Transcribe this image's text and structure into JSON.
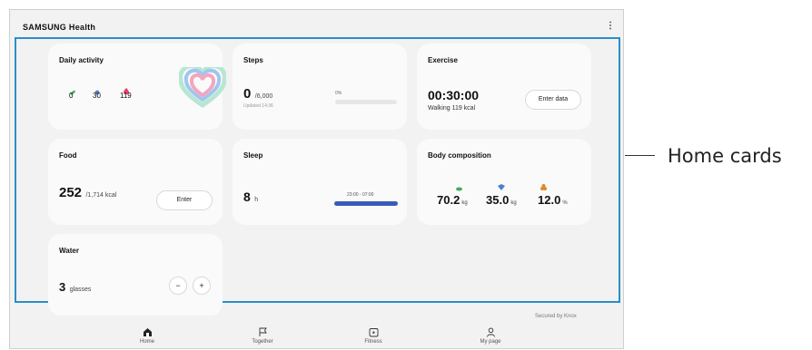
{
  "app": {
    "title": "SAMSUNG Health",
    "more_icon": "more-vertical-icon"
  },
  "cards": {
    "daily_activity": {
      "title": "Daily activity",
      "stats": [
        {
          "icon": "steps-icon",
          "color": "#3fae5a",
          "value": "0"
        },
        {
          "icon": "activity-time-icon",
          "color": "#4a7fd0",
          "value": "30"
        },
        {
          "icon": "calories-icon",
          "color": "#e0446a",
          "value": "119"
        }
      ]
    },
    "steps": {
      "title": "Steps",
      "value": "0",
      "goal": "/6,000",
      "updated": "Updated 14:36",
      "percent_label": "0%",
      "progress": 0
    },
    "exercise": {
      "title": "Exercise",
      "time": "00:30:00",
      "detail": "Walking 119 kcal",
      "button": "Enter data"
    },
    "food": {
      "title": "Food",
      "value": "252",
      "goal": "/1,714 kcal",
      "button": "Enter"
    },
    "sleep": {
      "title": "Sleep",
      "value": "8",
      "unit": "h",
      "range": "23:00 - 07:00",
      "bar_color": "#3a5bb5"
    },
    "body": {
      "title": "Body composition",
      "items": [
        {
          "icon": "weight-icon",
          "color": "#3fae5a",
          "value": "70.2",
          "unit": "kg"
        },
        {
          "icon": "muscle-icon",
          "color": "#4a7fd0",
          "value": "35.0",
          "unit": "kg"
        },
        {
          "icon": "body-fat-icon",
          "color": "#e08a2a",
          "value": "12.0",
          "unit": "%"
        }
      ]
    },
    "water": {
      "title": "Water",
      "value": "3",
      "unit": "glasses",
      "minus": "−",
      "plus": "+"
    }
  },
  "footer": {
    "knox": "Secured by Knox"
  },
  "nav": [
    {
      "label": "Home",
      "icon": "home-icon"
    },
    {
      "label": "Together",
      "icon": "flag-icon"
    },
    {
      "label": "Fitness",
      "icon": "play-icon"
    },
    {
      "label": "My page",
      "icon": "person-icon"
    }
  ],
  "callout": {
    "label": "Home cards"
  },
  "colors": {
    "accent": "#2a8fc7",
    "card_bg": "#fafafa",
    "screen_bg": "#f2f2f2"
  }
}
